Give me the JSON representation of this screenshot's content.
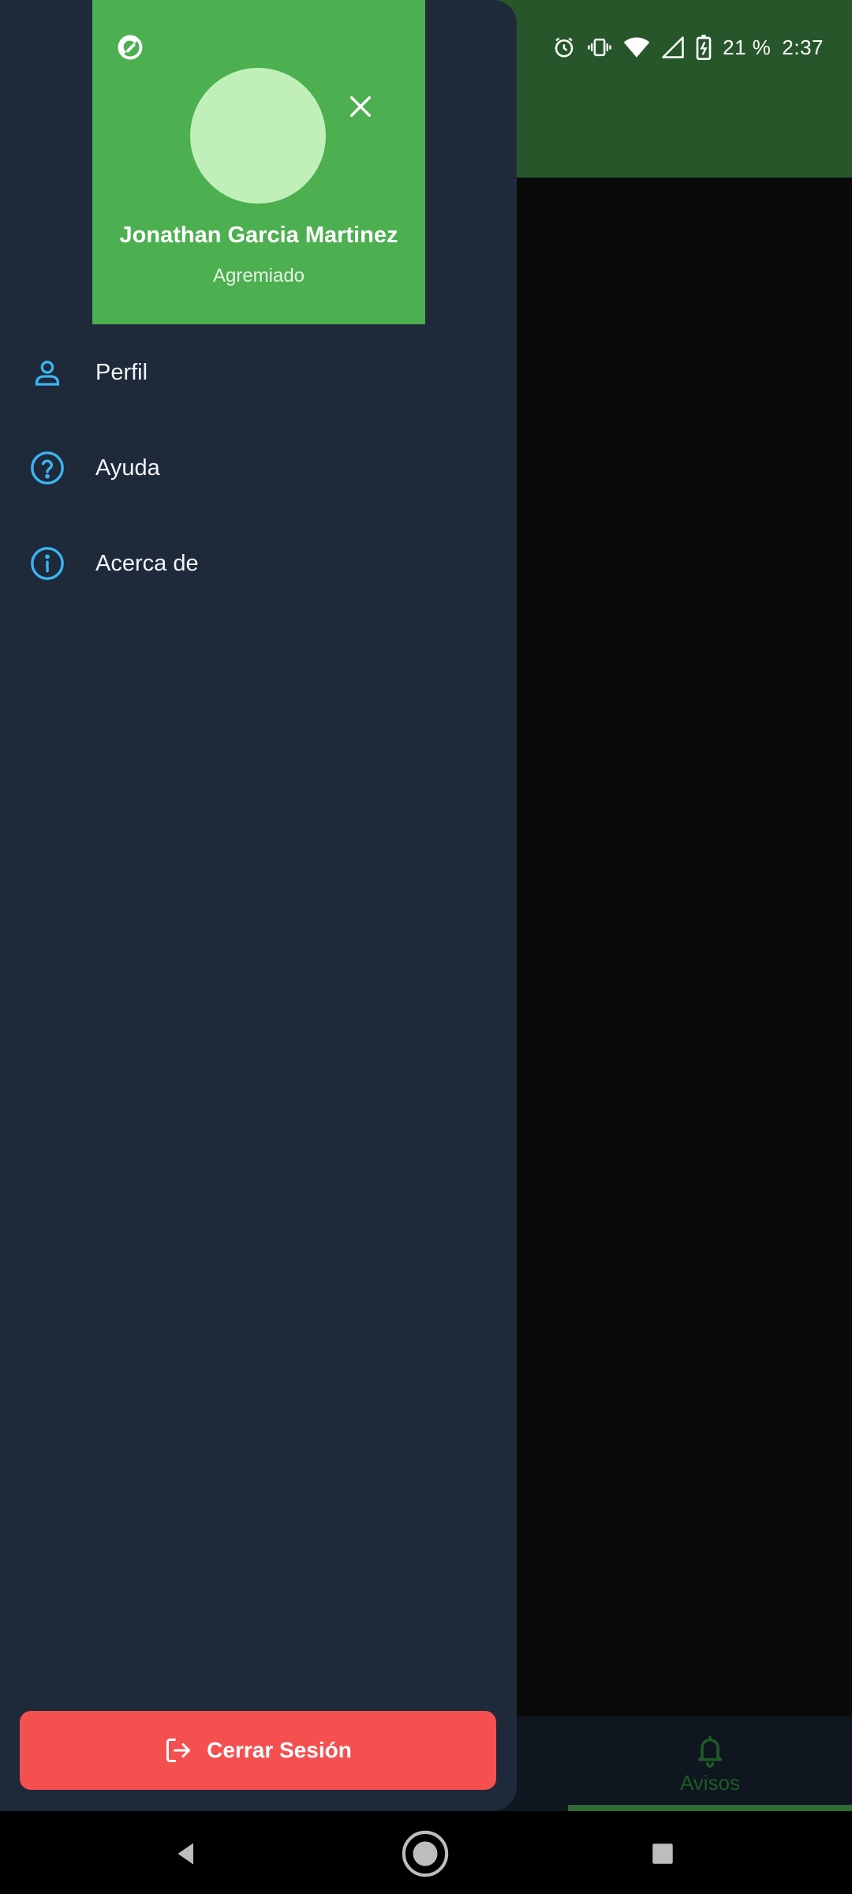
{
  "status_bar": {
    "battery_text": "21 %",
    "time": "2:37",
    "icons": [
      "alarm-icon",
      "vibrate-icon",
      "wifi-icon",
      "signal-icon",
      "battery-charging-icon"
    ]
  },
  "drawer": {
    "user_name": "Jonathan Garcia Martinez",
    "user_role": "Agremiado",
    "header_color": "#4caf50",
    "avatar_color": "#c0f0b8",
    "menu": [
      {
        "label": "Perfil",
        "icon": "person-icon"
      },
      {
        "label": "Ayuda",
        "icon": "help-circle-icon"
      },
      {
        "label": "Acerca de",
        "icon": "info-circle-icon"
      }
    ],
    "icon_color": "#3bb4f2",
    "logout": {
      "label": "Cerrar Sesión",
      "icon": "logout-icon",
      "color": "#f55050"
    }
  },
  "app": {
    "appbar_color": "#27562b",
    "bottom_nav": {
      "label": "Avisos",
      "icon": "bell-icon"
    }
  },
  "system_nav": [
    "back-icon",
    "home-icon",
    "recents-icon"
  ]
}
